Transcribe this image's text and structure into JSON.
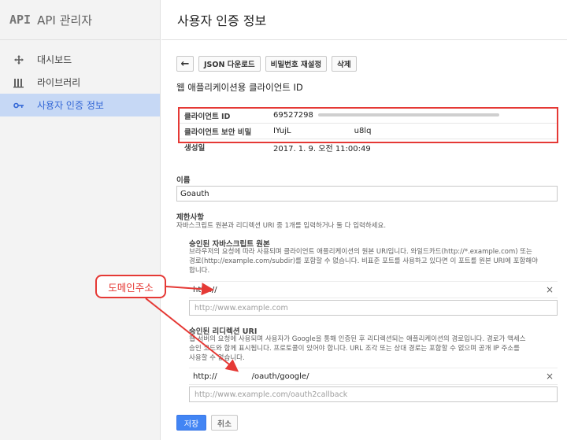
{
  "sidebar": {
    "logo": "API",
    "title": "API 관리자",
    "items": [
      {
        "label": "대시보드",
        "icon": "diamond-move-icon",
        "active": false
      },
      {
        "label": "라이브러리",
        "icon": "library-icon",
        "active": false
      },
      {
        "label": "사용자 인증 정보",
        "icon": "key-icon",
        "active": true
      }
    ]
  },
  "header": {
    "title": "사용자 인증 정보"
  },
  "toolbar": {
    "back_icon": "←",
    "json_download": "JSON 다운로드",
    "reset_secret": "비밀번호 재설정",
    "delete": "삭제"
  },
  "section_title": "웹 애플리케이션용 클라이언트 ID",
  "credentials": {
    "client_id_label": "클라이언트 ID",
    "client_id_value": "69527298",
    "client_secret_label": "클라이언트 보안 비밀",
    "client_secret_value": "IYujL",
    "client_secret_tail": "u8lq",
    "created_label": "생성일",
    "created_value": "2017. 1. 9. 오전 11:00:49"
  },
  "name_field": {
    "label": "이름",
    "value": "Goauth"
  },
  "restrictions": {
    "title": "제한사항",
    "desc": "자바스크립트 원본과 리디렉션 URI 중 1개를 입력하거나 둘 다 입력하세요.",
    "origins": {
      "title": "승인된 자바스크립트 원본",
      "help_1": "브라우저의 요청에 따라 사용되며 클라이언트 애플리케이션의 원본 URI입니다. 와일드카드(http://*.example.com) 또는",
      "help_2": "경로(http://example.com/subdir)를 포함할 수 없습니다. 비표준 포트를 사용하고 있다면 이 포트를 원본 URI에 포함해야",
      "help_3": "합니다.",
      "value": "http://",
      "placeholder": "http://www.example.com"
    },
    "redirects": {
      "title": "승인된 리디렉션 URI",
      "help_1": "웹 서버의 요청에 사용되며 사용자가 Google을 통해 인증된 후 리디렉션되는 애플리케이션의 경로입니다. 경로가 액세스",
      "help_2": "승인 코드와 함께 표시됩니다. 프로토콜이 있어야 합니다. URL 조각 또는 상대 경로는 포함할 수 없으며 공개 IP 주소를",
      "help_3": "사용할 수 없습니다.",
      "value_prefix": "http://",
      "value_suffix": "/oauth/google/",
      "placeholder": "http://www.example.com/oauth2callback"
    }
  },
  "buttons": {
    "save": "저장",
    "cancel": "취소",
    "remove": "×"
  },
  "annotation": {
    "label": "도메인주소"
  },
  "colors": {
    "accent": "#4285f4",
    "annotation": "#e53935",
    "active_nav_bg": "#c6d8f5"
  }
}
